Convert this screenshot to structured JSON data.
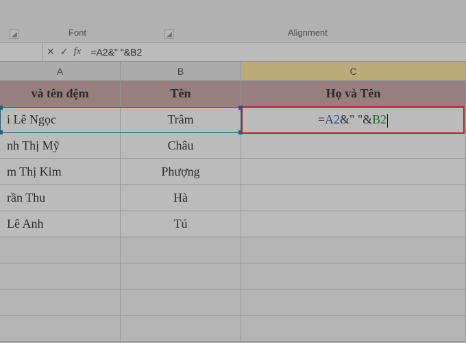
{
  "ribbon": {
    "group_font": "Font",
    "group_alignment": "Alignment"
  },
  "formula_bar": {
    "name_box": "",
    "cancel": "✕",
    "enter": "✓",
    "fx": "fx",
    "value": "=A2&\" \"&B2"
  },
  "columns": {
    "a": "A",
    "b": "B",
    "c": "C"
  },
  "headers": {
    "a": "và tên đệm",
    "b": "Tên",
    "c": "Họ và Tên"
  },
  "rows": [
    {
      "a": "i Lê Ngọc",
      "b": "Trâm"
    },
    {
      "a": "nh Thị Mỹ",
      "b": "Châu"
    },
    {
      "a": "m Thị Kim",
      "b": "Phượng"
    },
    {
      "a": "rần Thu",
      "b": "Hà"
    },
    {
      "a": "Lê Anh",
      "b": "Tú"
    }
  ],
  "active_formula": {
    "eq": "=",
    "ref_a": "A2",
    "amp1": "&\" \"&",
    "ref_b": "B2"
  }
}
